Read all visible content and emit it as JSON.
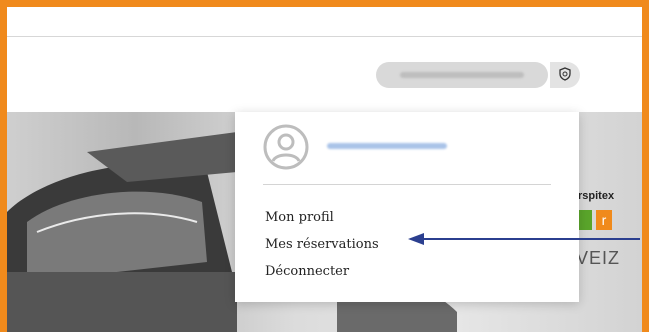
{
  "header": {
    "account_name_label": "",
    "shield_icon": "shield-icon"
  },
  "dropdown": {
    "avatar_icon": "user-avatar-icon",
    "account_name_label": "",
    "items": [
      {
        "label": "Mon profil"
      },
      {
        "label": "Mes réservations"
      },
      {
        "label": "Déconnecter"
      }
    ]
  },
  "hero": {
    "brand_text": "rspitex",
    "brand_letter": "r",
    "brand_sub": "VEIZ"
  },
  "colors": {
    "frame": "#f08a1c",
    "arrow": "#2b3f8f",
    "brand_orange": "#f08a1c",
    "brand_green": "#5aa52b"
  }
}
